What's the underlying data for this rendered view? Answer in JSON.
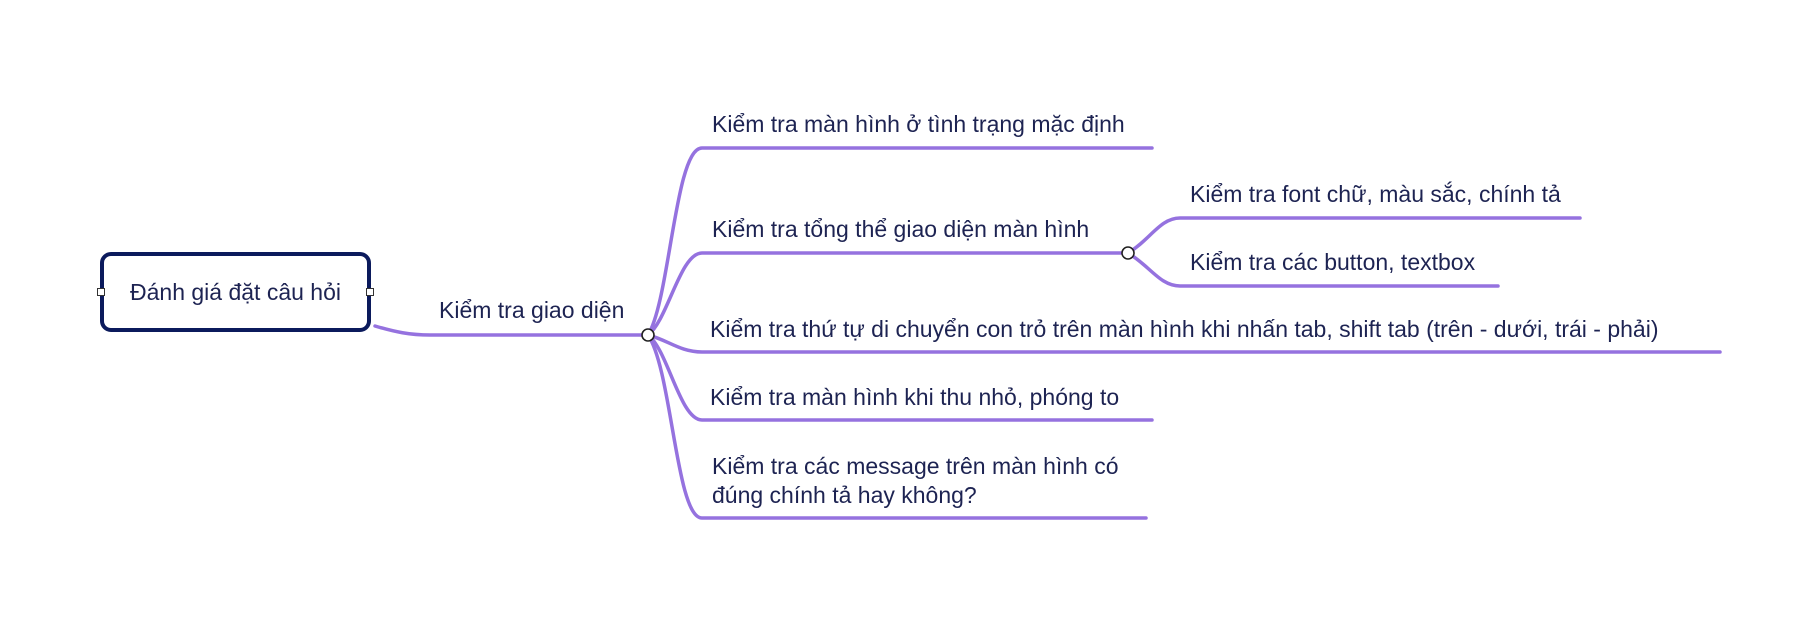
{
  "colors": {
    "branch": "#9572df",
    "text": "#1d2352",
    "root_border": "#0b1a5c"
  },
  "mindmap": {
    "root": {
      "label": "Đánh giá đặt câu hỏi"
    },
    "branch": {
      "label": "Kiểm tra giao diện",
      "children": [
        {
          "label": "Kiểm tra màn hình ở tình trạng mặc định"
        },
        {
          "label": "Kiểm tra tổng thể giao diện màn hình",
          "children": [
            {
              "label": "Kiểm tra font chữ, màu sắc, chính tả"
            },
            {
              "label": "Kiểm tra các button, textbox"
            }
          ]
        },
        {
          "label": "Kiểm tra thứ tự di chuyển con trỏ trên màn hình khi nhấn tab, shift tab (trên - dưới, trái - phải)"
        },
        {
          "label": "Kiểm tra màn hình khi thu nhỏ, phóng to"
        },
        {
          "lines": [
            "Kiểm tra các message trên màn hình có",
            "đúng chính tả hay không?"
          ]
        }
      ]
    }
  }
}
